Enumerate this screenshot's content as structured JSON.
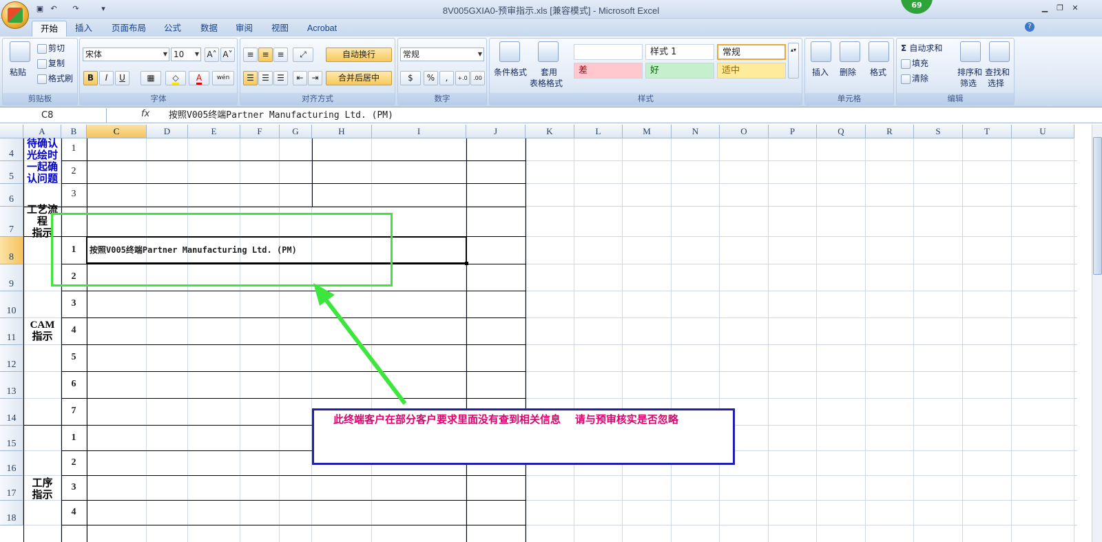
{
  "titlebar": {
    "title": "8V005GXIA0-预审指示.xls  [兼容模式] - Microsoft Excel",
    "badge": "69",
    "qa_save": "▣",
    "qa_undo": "↶",
    "qa_redo": "↷",
    "qa_more": "▾",
    "win_min": "▁",
    "win_max": "❐",
    "win_close": "✕"
  },
  "tabs": [
    "开始",
    "插入",
    "页面布局",
    "公式",
    "数据",
    "审阅",
    "视图",
    "Acrobat"
  ],
  "ribbon": {
    "clipboard": {
      "label": "剪贴板",
      "paste": "粘贴",
      "cut": "剪切",
      "copy": "复制",
      "format_painter": "格式刷"
    },
    "font": {
      "label": "字体",
      "name": "宋体",
      "size": "10",
      "grow": "A˄",
      "shrink": "A˅",
      "bold": "B",
      "italic": "I",
      "underline": "U",
      "wen": "wén"
    },
    "alignment": {
      "label": "对齐方式",
      "wrap": "自动换行",
      "merge": "合并后居中"
    },
    "number": {
      "label": "数字",
      "format": "常规",
      "percent": "%",
      "comma": ",",
      "inc": "+.0",
      "dec": ".00"
    },
    "styles": {
      "label": "样式",
      "conditional": "条件格式",
      "table": "套用",
      "table2": "表格格式",
      "cells": [
        "",
        "样式 1",
        "常规",
        "差",
        "好",
        "适中"
      ]
    },
    "cells": {
      "label": "单元格",
      "insert": "插入",
      "delete": "删除",
      "format": "格式"
    },
    "editing": {
      "label": "编辑",
      "autosum": "自动求和",
      "fill": "填充",
      "clear": "清除",
      "sort": "排序和",
      "sort2": "筛选",
      "find": "查找和",
      "find2": "选择"
    }
  },
  "formula_bar": {
    "name_box": "C8",
    "fx": "fx",
    "content": "按照V005终端Partner Manufacturing Ltd. (PM)"
  },
  "columns": [
    "A",
    "B",
    "C",
    "D",
    "E",
    "F",
    "G",
    "H",
    "I",
    "J",
    "K",
    "L",
    "M",
    "N",
    "O",
    "P",
    "Q",
    "R",
    "S",
    "T",
    "U"
  ],
  "rows": [
    "4",
    "5",
    "6",
    "7",
    "8",
    "9",
    "10",
    "11",
    "12",
    "13",
    "14",
    "15",
    "16",
    "17",
    "18"
  ],
  "cells": {
    "a4_label": [
      "待确认",
      "光绘时",
      "一起确",
      "认问题"
    ],
    "a7_label": [
      "工艺流程",
      "指示"
    ],
    "a10_label": [
      "CAM",
      "指示"
    ],
    "a15_label": [
      "工序",
      "指示"
    ],
    "b_numbers_confirm": [
      "1",
      "2",
      "3"
    ],
    "b_numbers_cam": [
      "1",
      "2",
      "3",
      "4",
      "5",
      "6",
      "7"
    ],
    "b_numbers_proc": [
      "1",
      "2",
      "3",
      "4"
    ],
    "c8": "按照V005终端Partner Manufacturing Ltd. (PM)"
  },
  "annotation": {
    "text": "此终端客户在部分客户要求里面没有查到相关信息    请与预审核实是否忽略",
    "text_color": "#e0006e",
    "box_color": "#1e1eb4",
    "highlight_color": "#3ce63c"
  }
}
